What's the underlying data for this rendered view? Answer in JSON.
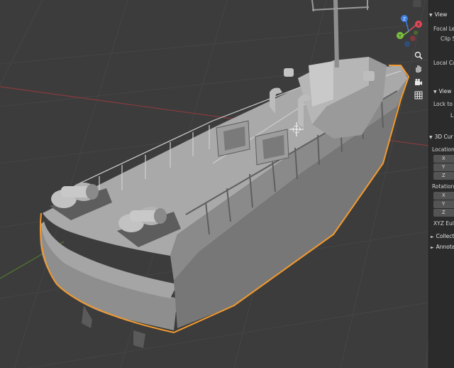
{
  "panel": {
    "view_header": "View",
    "focal_length": "Focal Len",
    "clip_start": "Clip S",
    "local_camera": "Local Cam",
    "view_lock_header": "View",
    "lock_to": "Lock to O",
    "lock_l": "L",
    "cursor_header": "3D Cur",
    "location_label": "Location:",
    "rotation_label": "Rotation",
    "axis_x": "X",
    "axis_y": "Y",
    "axis_z": "Z",
    "rot_mode": "XYZ Eule",
    "collections_header": "Collect",
    "annotations_header": "Annota"
  },
  "gizmo": {
    "x_label": "X",
    "y_label": "Y",
    "z_label": "Z",
    "x_color": "#e04a5a",
    "y_color": "#7bc23f",
    "z_color": "#3f7fe0"
  },
  "icons": [
    "zoom-icon",
    "hand-icon",
    "camera-icon",
    "grid-icon"
  ],
  "selection_outline_color": "#f29a2e"
}
